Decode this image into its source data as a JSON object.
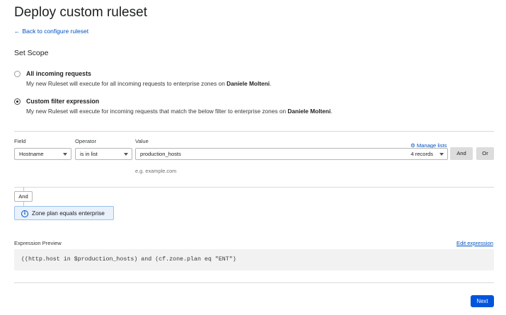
{
  "page": {
    "title": "Deploy custom ruleset",
    "back_link": "Back to configure ruleset",
    "back_arrow": "←"
  },
  "scope": {
    "heading": "Set Scope",
    "options": [
      {
        "title": "All incoming requests",
        "desc_prefix": "My new Ruleset will execute for all incoming requests to enterprise zones on ",
        "account": "Daniele Molteni",
        "desc_suffix": ".",
        "selected": false
      },
      {
        "title": "Custom filter expression",
        "desc_prefix": "My new Ruleset will execute for incoming requests that match the below filter to enterprise zones on ",
        "account": "Daniele Molteni",
        "desc_suffix": ".",
        "selected": true
      }
    ]
  },
  "filter": {
    "field_label": "Field",
    "operator_label": "Operator",
    "value_label": "Value",
    "manage_lists": "Manage lists",
    "field_value": "Hostname",
    "operator_value": "is in list",
    "value_value": "production_hosts",
    "records": "4 records",
    "and_button": "And",
    "or_button": "Or",
    "value_hint": "e.g. example.com"
  },
  "condition": {
    "and_label": "And",
    "zone_text": "Zone plan equals enterprise"
  },
  "expression": {
    "label": "Expression Preview",
    "edit_link": "Edit expression",
    "text": "((http.host in $production_hosts) and (cf.zone.plan eq \"ENT\")"
  },
  "footer": {
    "next_button": "Next"
  },
  "colors": {
    "accent": "#0051c3",
    "primary_button": "#0055dc",
    "info_bg": "#e8f1fc"
  }
}
